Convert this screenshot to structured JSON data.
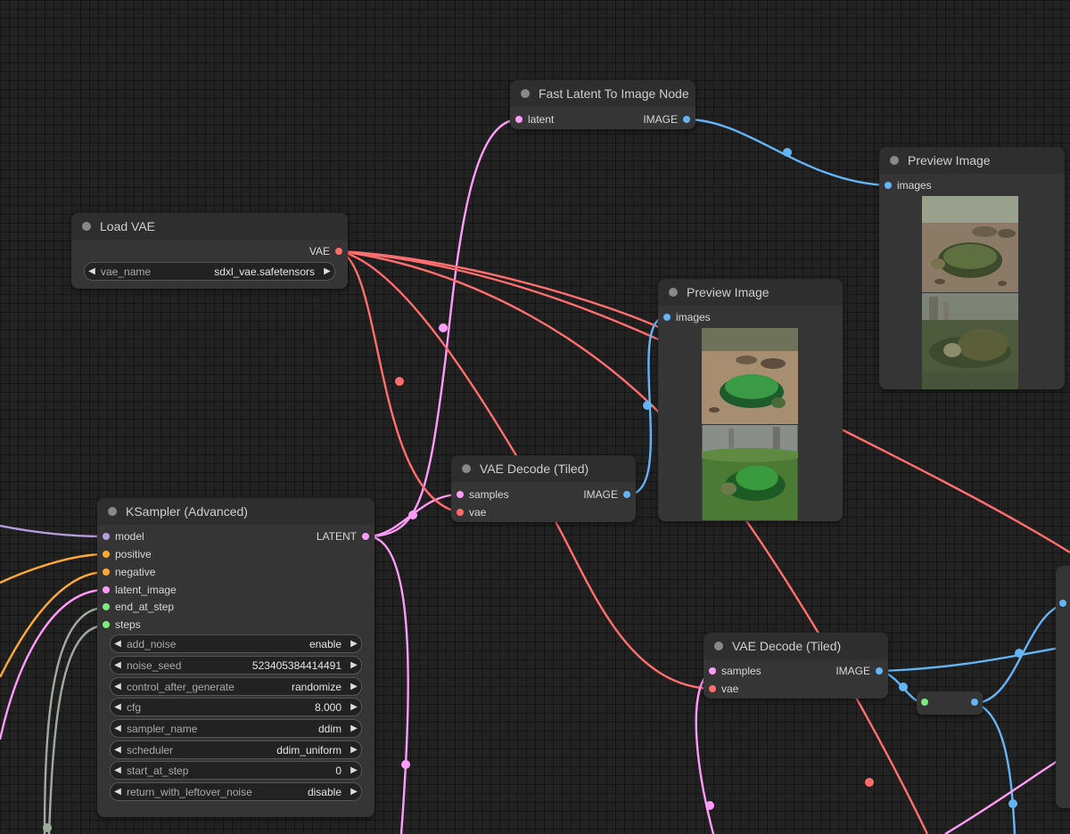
{
  "colors": {
    "latent": "#ff9cf9",
    "image": "#64b5f6",
    "vae": "#ff6e6e",
    "model": "#b39ddb",
    "conditioning": "#ffa931",
    "int": "#7eea7e",
    "int_gray": "#a0ab9f"
  },
  "nodes": {
    "fast_latent": {
      "title": "Fast Latent To Image Node",
      "input": "latent",
      "output": "IMAGE"
    },
    "preview1": {
      "title": "Preview Image",
      "input": "images",
      "image_names": [
        "turtle-image-1",
        "turtle-image-2"
      ]
    },
    "load_vae": {
      "title": "Load VAE",
      "output": "VAE",
      "widget_name": "vae_name",
      "widget_value": "sdxl_vae.safetensors"
    },
    "preview2": {
      "title": "Preview Image",
      "input": "images",
      "image_names": [
        "turtle-image-3",
        "turtle-image-4"
      ]
    },
    "vae_decode1": {
      "title": "VAE Decode (Tiled)",
      "inputs": [
        "samples",
        "vae"
      ],
      "output": "IMAGE"
    },
    "ksampler": {
      "title": "KSampler (Advanced)",
      "inputs": [
        "model",
        "positive",
        "negative",
        "latent_image",
        "end_at_step",
        "steps"
      ],
      "output": "LATENT",
      "widgets": [
        {
          "name": "add_noise",
          "value": "enable"
        },
        {
          "name": "noise_seed",
          "value": "523405384414491"
        },
        {
          "name": "control_after_generate",
          "value": "randomize"
        },
        {
          "name": "cfg",
          "value": "8.000"
        },
        {
          "name": "sampler_name",
          "value": "ddim"
        },
        {
          "name": "scheduler",
          "value": "ddim_uniform"
        },
        {
          "name": "start_at_step",
          "value": "0"
        },
        {
          "name": "return_with_leftover_noise",
          "value": "disable"
        }
      ]
    },
    "vae_decode2": {
      "title": "VAE Decode (Tiled)",
      "inputs": [
        "samples",
        "vae"
      ],
      "output": "IMAGE"
    }
  }
}
